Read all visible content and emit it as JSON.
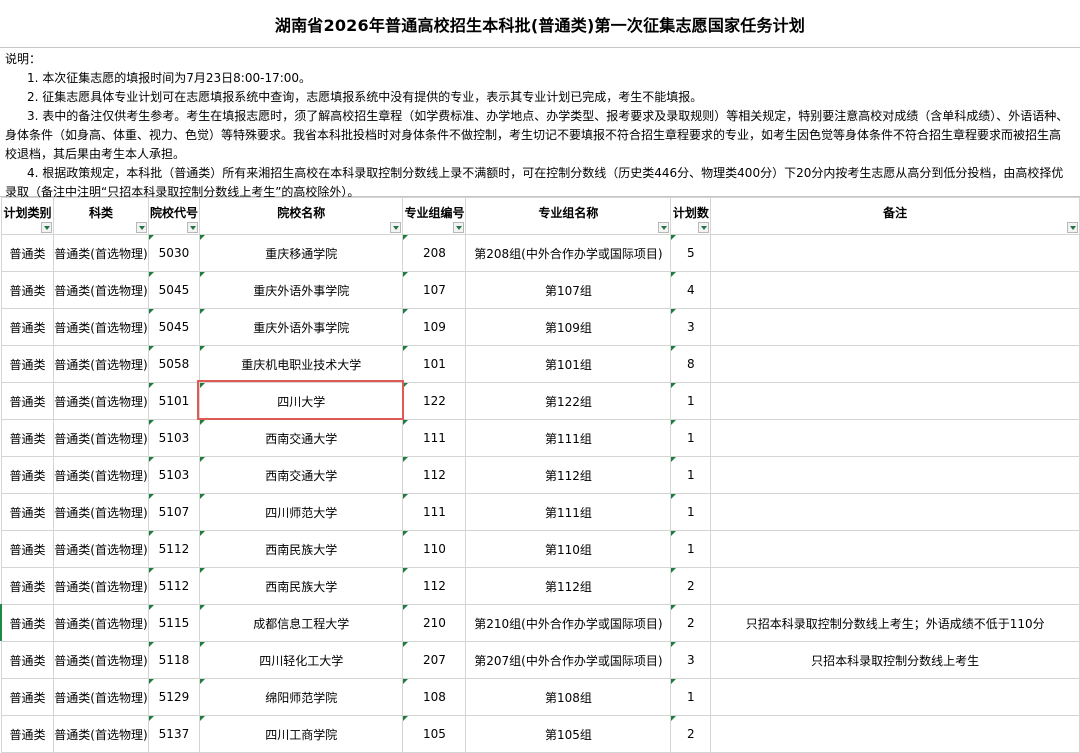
{
  "title": "湖南省2026年普通高校招生本科批(普通类)第一次征集志愿国家任务计划",
  "notes": {
    "heading": "说明：",
    "lines": [
      "1. 本次征集志愿的填报时间为7月23日8:00-17:00。",
      "2. 征集志愿具体专业计划可在志愿填报系统中查询，志愿填报系统中没有提供的专业，表示其专业计划已完成，考生不能填报。",
      "3. 表中的备注仅供考生参考。考生在填报志愿时，须了解高校招生章程（如学费标准、办学地点、办学类型、报考要求及录取规则）等相关规定，特别要注意高校对成绩（含单科成绩）、外语语种、身体条件（如身高、体重、视力、色觉）等特殊要求。我省本科批投档时对身体条件不做控制，考生切记不要填报不符合招生章程要求的专业，如考生因色觉等身体条件不符合招生章程要求而被招生高校退档，其后果由考生本人承担。",
      "4. 根据政策规定，本科批（普通类）所有来湘招生高校在本科录取控制分数线上录不满额时，可在控制分数线（历史类446分、物理类400分）下20分内按考生志愿从高分到低分投档，由高校择优录取（备注中注明“只招本科录取控制分数线上考生”的高校除外）。"
    ]
  },
  "columns": [
    "计划类别",
    "科类",
    "院校代号",
    "院校名称",
    "专业组编号",
    "专业组名称",
    "计划数",
    "备注"
  ],
  "rows": [
    [
      "普通类",
      "普通类(首选物理)",
      "5030",
      "重庆移通学院",
      "208",
      "第208组(中外合作办学或国际项目)",
      "5",
      ""
    ],
    [
      "普通类",
      "普通类(首选物理)",
      "5045",
      "重庆外语外事学院",
      "107",
      "第107组",
      "4",
      ""
    ],
    [
      "普通类",
      "普通类(首选物理)",
      "5045",
      "重庆外语外事学院",
      "109",
      "第109组",
      "3",
      ""
    ],
    [
      "普通类",
      "普通类(首选物理)",
      "5058",
      "重庆机电职业技术大学",
      "101",
      "第101组",
      "8",
      ""
    ],
    [
      "普通类",
      "普通类(首选物理)",
      "5101",
      "四川大学",
      "122",
      "第122组",
      "1",
      ""
    ],
    [
      "普通类",
      "普通类(首选物理)",
      "5103",
      "西南交通大学",
      "111",
      "第111组",
      "1",
      ""
    ],
    [
      "普通类",
      "普通类(首选物理)",
      "5103",
      "西南交通大学",
      "112",
      "第112组",
      "1",
      ""
    ],
    [
      "普通类",
      "普通类(首选物理)",
      "5107",
      "四川师范大学",
      "111",
      "第111组",
      "1",
      ""
    ],
    [
      "普通类",
      "普通类(首选物理)",
      "5112",
      "西南民族大学",
      "110",
      "第110组",
      "1",
      ""
    ],
    [
      "普通类",
      "普通类(首选物理)",
      "5112",
      "西南民族大学",
      "112",
      "第112组",
      "2",
      ""
    ],
    [
      "普通类",
      "普通类(首选物理)",
      "5115",
      "成都信息工程大学",
      "210",
      "第210组(中外合作办学或国际项目)",
      "2",
      "只招本科录取控制分数线上考生；外语成绩不低于110分"
    ],
    [
      "普通类",
      "普通类(首选物理)",
      "5118",
      "四川轻化工大学",
      "207",
      "第207组(中外合作办学或国际项目)",
      "3",
      "只招本科录取控制分数线上考生"
    ],
    [
      "普通类",
      "普通类(首选物理)",
      "5129",
      "绵阳师范学院",
      "108",
      "第108组",
      "1",
      ""
    ],
    [
      "普通类",
      "普通类(首选物理)",
      "5137",
      "四川工商学院",
      "105",
      "第105组",
      "2",
      ""
    ]
  ],
  "highlighted_row_index": 4,
  "colors": {
    "highlight": "#e05a54",
    "filter_arrow": "#217346",
    "comment_marker": "#1e7c3e"
  },
  "icons": {
    "filter": "dropdown-filter-icon",
    "comment": "cell-comment-marker"
  }
}
